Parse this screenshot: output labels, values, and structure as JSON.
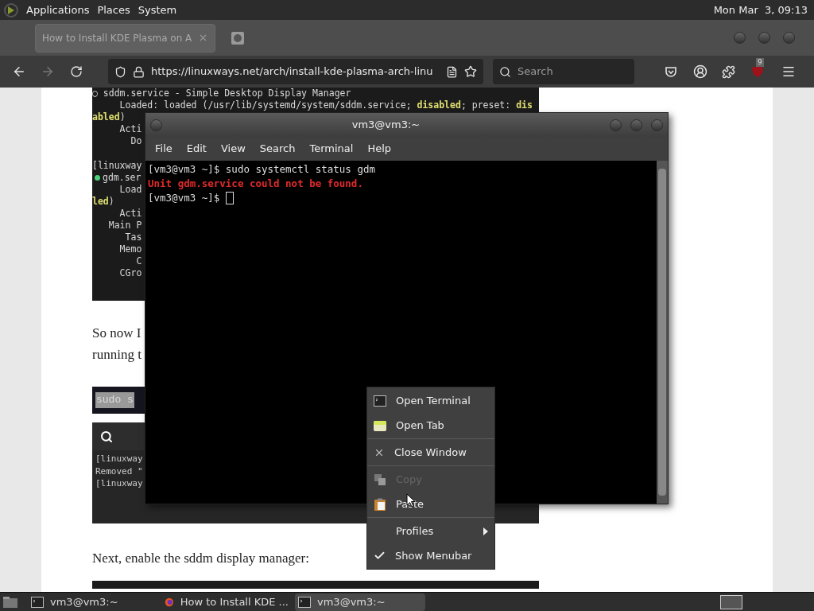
{
  "top_panel": {
    "menus": [
      "Applications",
      "Places",
      "System"
    ],
    "clock": "Mon Mar  3, 09:13"
  },
  "browser": {
    "tabs": [
      {
        "title": "How to Install KDE Plasma on A",
        "selected": true
      }
    ],
    "can_go_forward": false,
    "address": "https://linuxways.net/arch/install-kde-plasma-arch-linu",
    "search_placeholder": "Search",
    "extension_badge": "9"
  },
  "page": {
    "code_block": [
      {
        "gap_before": false,
        "status_dot": false,
        "segments": [
          {
            "text": "○ sddm.service - Simple Desktop Display Manager",
            "highlighted": false
          }
        ]
      },
      {
        "gap_before": false,
        "status_dot": false,
        "segments": [
          {
            "text": "     Loaded: loaded (/usr/lib/systemd/system/sddm.service; ",
            "highlighted": false
          },
          {
            "text": "disabled",
            "highlighted": true
          },
          {
            "text": "; preset: ",
            "highlighted": false
          },
          {
            "text": "dis",
            "highlighted": true
          }
        ]
      },
      {
        "gap_before": false,
        "status_dot": false,
        "segments": [
          {
            "text": "abled",
            "highlighted": true
          },
          {
            "text": ")",
            "highlighted": false
          }
        ]
      },
      {
        "gap_before": false,
        "status_dot": false,
        "segments": [
          {
            "text": "     Acti",
            "highlighted": false
          }
        ]
      },
      {
        "gap_before": false,
        "status_dot": false,
        "segments": [
          {
            "text": "       Do",
            "highlighted": false
          }
        ]
      },
      {
        "gap_before": true,
        "status_dot": false,
        "segments": [
          {
            "text": "[linuxway",
            "highlighted": false
          }
        ]
      },
      {
        "gap_before": false,
        "status_dot": true,
        "segments": [
          {
            "text": "gdm.ser",
            "highlighted": false
          }
        ]
      },
      {
        "gap_before": false,
        "status_dot": false,
        "segments": [
          {
            "text": "     Load",
            "highlighted": false
          }
        ]
      },
      {
        "gap_before": false,
        "status_dot": false,
        "segments": [
          {
            "text": "led",
            "highlighted": true
          },
          {
            "text": ")",
            "highlighted": false
          }
        ]
      },
      {
        "gap_before": false,
        "status_dot": false,
        "segments": [
          {
            "text": "     Acti",
            "highlighted": false
          }
        ]
      },
      {
        "gap_before": false,
        "status_dot": false,
        "segments": [
          {
            "text": "   Main P",
            "highlighted": false
          }
        ]
      },
      {
        "gap_before": false,
        "status_dot": false,
        "segments": [
          {
            "text": "      Tas",
            "highlighted": false
          }
        ]
      },
      {
        "gap_before": false,
        "status_dot": false,
        "segments": [
          {
            "text": "     Memo",
            "highlighted": false
          }
        ]
      },
      {
        "gap_before": false,
        "status_dot": false,
        "segments": [
          {
            "text": "        C",
            "highlighted": false
          }
        ]
      },
      {
        "gap_before": false,
        "status_dot": false,
        "segments": [
          {
            "text": "     CGro",
            "highlighted": false
          }
        ]
      }
    ],
    "paragraph_lines": [
      "So now I",
      "running t"
    ],
    "inline_code": "sudo s",
    "screenshot_lines": [
      "[linuxway",
      "Removed \"",
      "[linuxway"
    ],
    "paragraph_2": "Next, enable the sddm display manager:"
  },
  "terminal": {
    "title": "vm3@vm3:~",
    "menus": [
      "File",
      "Edit",
      "View",
      "Search",
      "Terminal",
      "Help"
    ],
    "lines": [
      {
        "text": "[vm3@vm3 ~]$ sudo systemctl status gdm",
        "kind": "output"
      },
      {
        "text": "Unit gdm.service could not be found.",
        "kind": "error"
      },
      {
        "text": "[vm3@vm3 ~]$ ",
        "kind": "prompt"
      }
    ]
  },
  "context_menu": {
    "groups": [
      [
        {
          "label": "Open Terminal",
          "kind": "terminal",
          "disabled": false
        },
        {
          "label": "Open Tab",
          "kind": "tab",
          "disabled": false
        }
      ],
      [
        {
          "label": "Close Window",
          "kind": "close",
          "disabled": false
        }
      ],
      [
        {
          "label": "Copy",
          "kind": "copy",
          "disabled": true
        },
        {
          "label": "Paste",
          "kind": "paste",
          "disabled": false
        }
      ],
      [
        {
          "label": "Profiles",
          "kind": "submenu",
          "disabled": false
        },
        {
          "label": "Show Menubar",
          "kind": "check",
          "disabled": false
        }
      ]
    ]
  },
  "taskbar": {
    "tasks": [
      {
        "title": "vm3@vm3:~",
        "kind": "terminal",
        "selected": false
      },
      {
        "title": "How to Install KDE ...",
        "kind": "browser",
        "selected": false
      },
      {
        "title": "vm3@vm3:~",
        "kind": "terminal",
        "selected": true
      }
    ]
  }
}
